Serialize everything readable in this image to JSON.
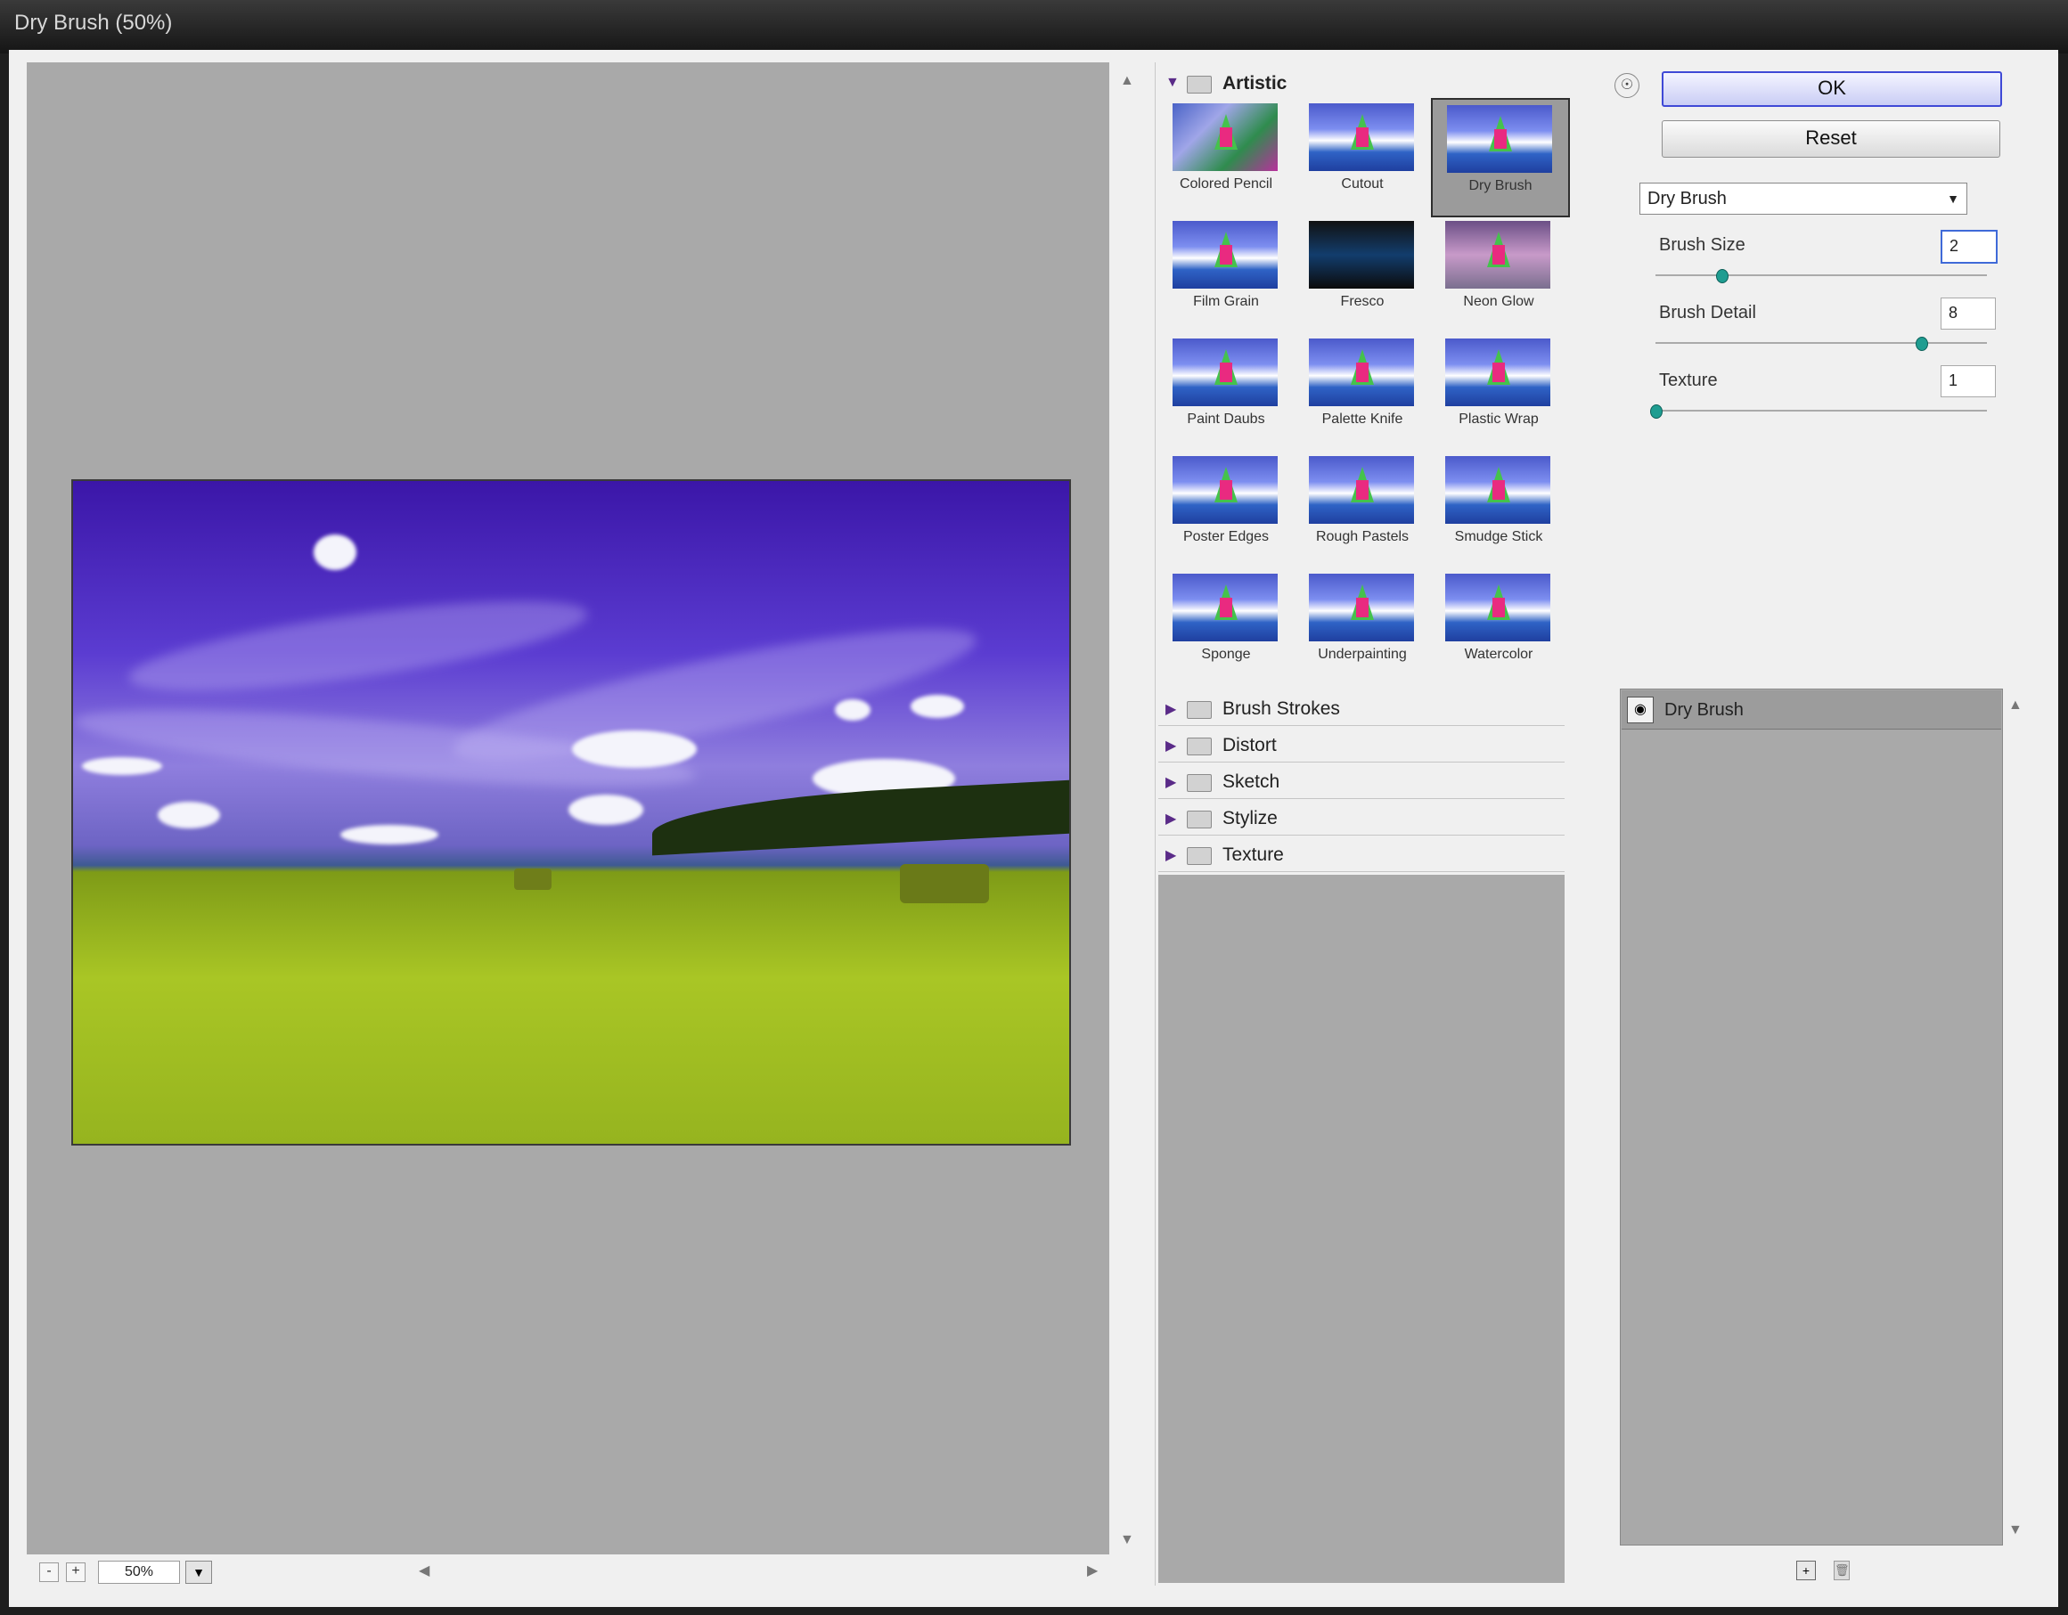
{
  "window": {
    "title": "Dry Brush (50%)"
  },
  "preview": {
    "zoom_value": "50%",
    "zoom_out_symbol": "-",
    "zoom_in_symbol": "+"
  },
  "gallery": {
    "open_category": "Artistic",
    "filters": [
      "Colored Pencil",
      "Cutout",
      "Dry Brush",
      "Film Grain",
      "Fresco",
      "Neon Glow",
      "Paint Daubs",
      "Palette Knife",
      "Plastic Wrap",
      "Poster Edges",
      "Rough Pastels",
      "Smudge Stick",
      "Sponge",
      "Underpainting",
      "Watercolor"
    ],
    "selected_filter": "Dry Brush",
    "collapsed_categories": [
      "Brush Strokes",
      "Distort",
      "Sketch",
      "Stylize",
      "Texture"
    ]
  },
  "options": {
    "ok_label": "OK",
    "reset_label": "Reset",
    "selected_filter": "Dry Brush",
    "params": [
      {
        "label": "Brush Size",
        "value": "2",
        "level": 0.2
      },
      {
        "label": "Brush Detail",
        "value": "8",
        "level": 0.8
      },
      {
        "label": "Texture",
        "value": "1",
        "level": 0.0
      }
    ]
  },
  "layers": {
    "items": [
      "Dry Brush"
    ]
  },
  "icons": {
    "category_open": "triangle-down-icon",
    "category_closed": "triangle-right-icon",
    "folder": "folder-icon",
    "visibility": "eye-icon",
    "new_layer": "new-effect-layer-icon",
    "delete_layer": "trash-icon",
    "info": "info-icon"
  },
  "colors": {
    "accent": "#3f49d6",
    "canvas_bg": "#a9a9a9",
    "panel_bg": "#f0f0f0",
    "slider_knob": "#1f9d91"
  }
}
